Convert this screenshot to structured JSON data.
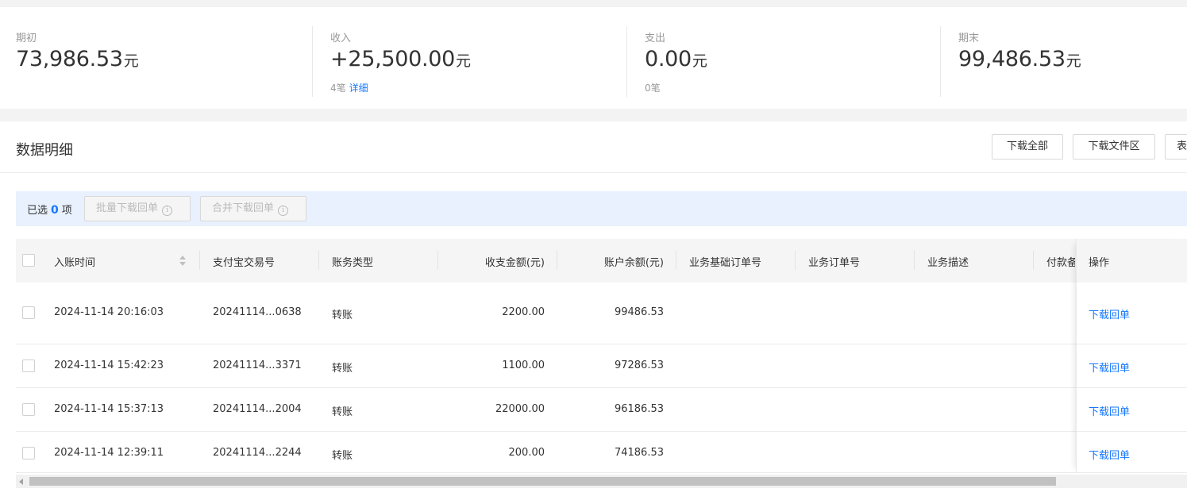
{
  "summary": {
    "opening": {
      "label": "期初",
      "amount": "73,986.53",
      "unit": "元"
    },
    "income": {
      "label": "收入",
      "amount": "+25,500.00",
      "unit": "元",
      "count": "4笔",
      "detail_link": "详细"
    },
    "expense": {
      "label": "支出",
      "amount": "0.00",
      "unit": "元",
      "count": "0笔"
    },
    "closing": {
      "label": "期末",
      "amount": "99,486.53",
      "unit": "元"
    }
  },
  "panel": {
    "title": "数据明细",
    "buttons": {
      "download_all": "下载全部",
      "download_files": "下载文件区",
      "partial": "表"
    }
  },
  "selection": {
    "prefix": "已选",
    "count": "0",
    "suffix": "项",
    "batch_download": "批量下载回单",
    "merge_download": "合并下载回单"
  },
  "table": {
    "columns": {
      "time": "入账时间",
      "trade_no": "支付宝交易号",
      "type": "账务类型",
      "amount": "收支金额(元)",
      "balance": "账户余额(元)",
      "base_order": "业务基础订单号",
      "order": "业务订单号",
      "desc": "业务描述",
      "remark": "付款备",
      "action": "操作"
    },
    "rows": [
      {
        "time": "2024-11-14 20:16:03",
        "trade_no": "20241114...0638",
        "type": "转账",
        "amount": "2200.00",
        "balance": "99486.53",
        "action": "下载回单"
      },
      {
        "time": "2024-11-14 15:42:23",
        "trade_no": "20241114...3371",
        "type": "转账",
        "amount": "1100.00",
        "balance": "97286.53",
        "action": "下载回单"
      },
      {
        "time": "2024-11-14 15:37:13",
        "trade_no": "20241114...2004",
        "type": "转账",
        "amount": "22000.00",
        "balance": "96186.53",
        "action": "下载回单"
      },
      {
        "time": "2024-11-14 12:39:11",
        "trade_no": "20241114...2244",
        "type": "转账",
        "amount": "200.00",
        "balance": "74186.53",
        "action": "下载回单"
      }
    ]
  },
  "colors": {
    "accent": "#1677ff",
    "selection_bar": "#e8f1fd"
  }
}
